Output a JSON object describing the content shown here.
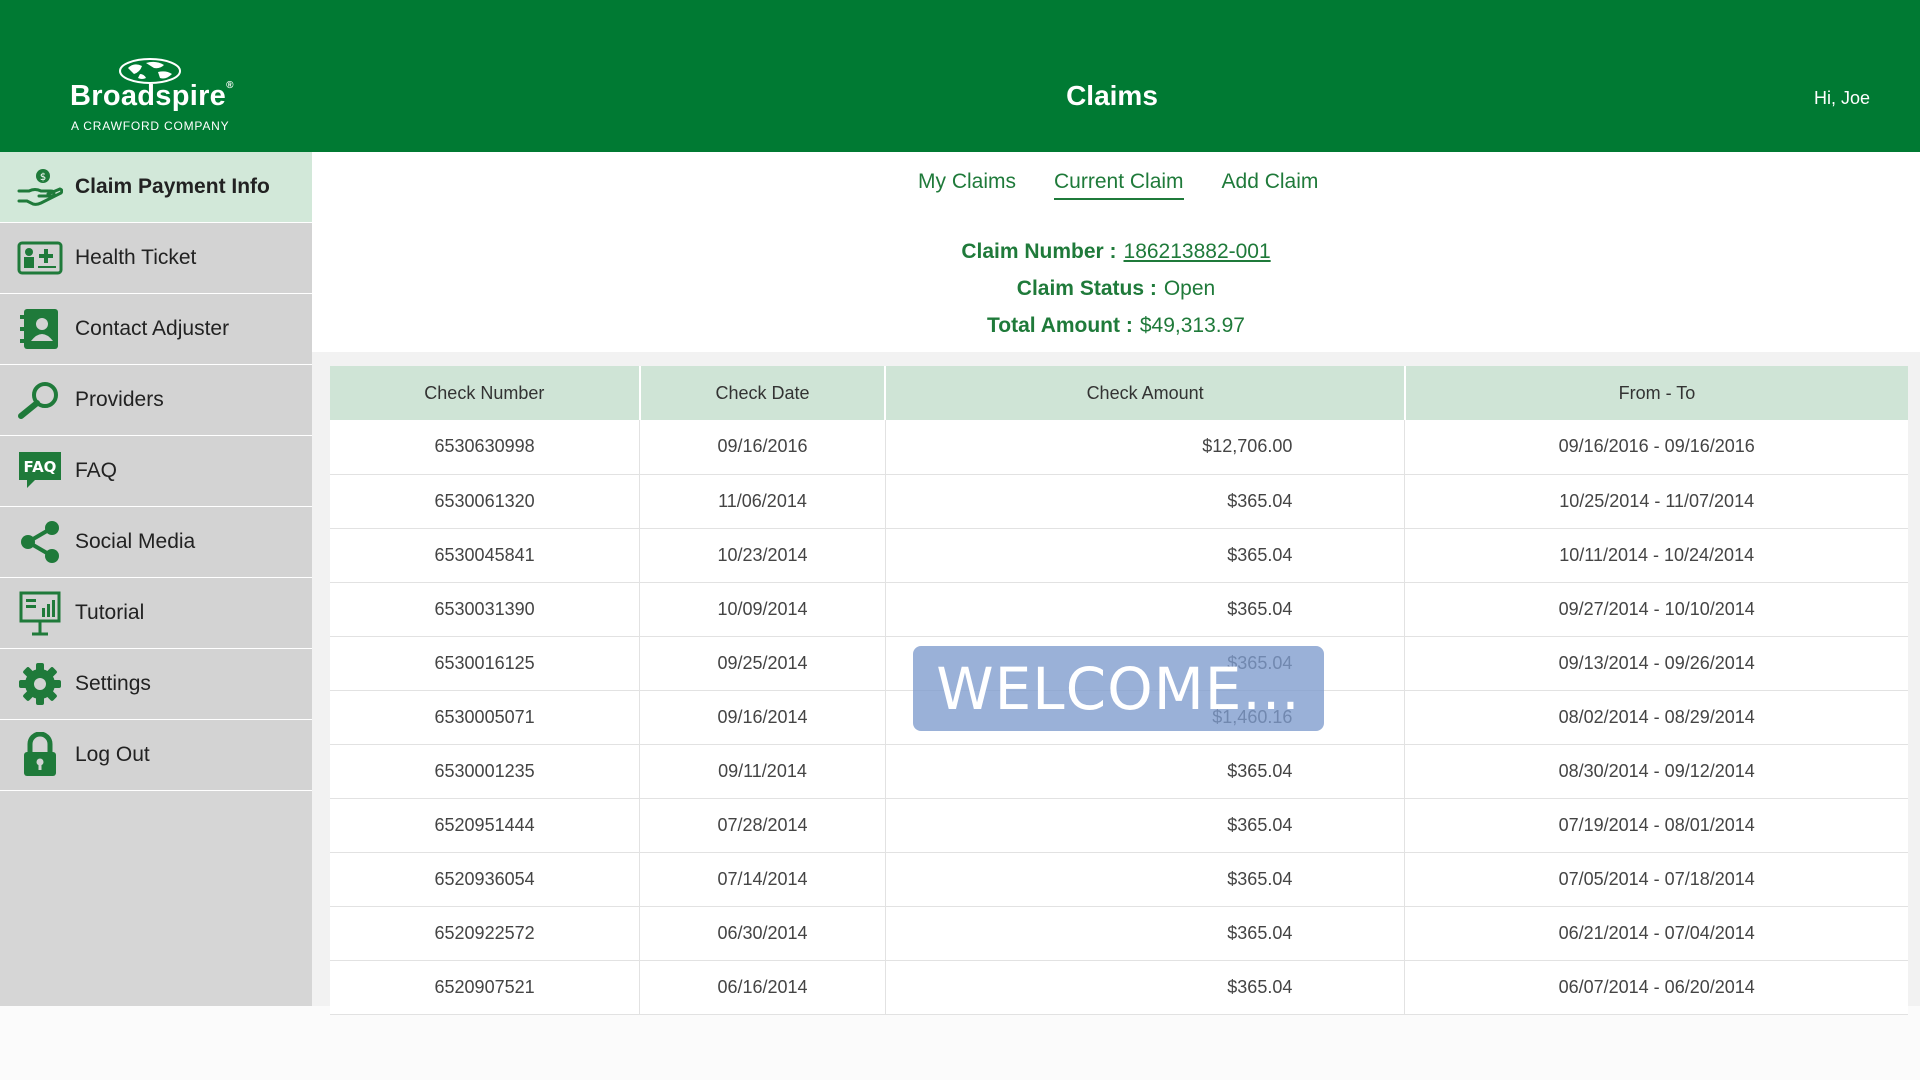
{
  "header": {
    "brand": "Broadspire",
    "brand_tagline": "A CRAWFORD COMPANY",
    "title": "Claims",
    "greeting": "Hi, Joe"
  },
  "sidebar": {
    "items": [
      {
        "label": "Claim Payment Info",
        "icon": "hand-money-icon",
        "active": true
      },
      {
        "label": "Health Ticket",
        "icon": "health-card-icon"
      },
      {
        "label": "Contact Adjuster",
        "icon": "contact-book-icon"
      },
      {
        "label": "Providers",
        "icon": "magnifier-icon"
      },
      {
        "label": "FAQ",
        "icon": "faq-icon"
      },
      {
        "label": "Social Media",
        "icon": "share-icon"
      },
      {
        "label": "Tutorial",
        "icon": "presentation-board-icon"
      },
      {
        "label": "Settings",
        "icon": "gear-icon"
      },
      {
        "label": "Log Out",
        "icon": "lock-icon"
      }
    ]
  },
  "tabs": [
    {
      "label": "My Claims"
    },
    {
      "label": "Current Claim",
      "active": true
    },
    {
      "label": "Add Claim"
    }
  ],
  "claim": {
    "number_label": "Claim Number :",
    "number": "186213882-001",
    "status_label": "Claim Status :",
    "status": "Open",
    "total_label": "Total Amount :",
    "total": "$49,313.97"
  },
  "table": {
    "columns": [
      "Check Number",
      "Check Date",
      "Check Amount",
      "From - To"
    ],
    "rows": [
      [
        "6530630998",
        "09/16/2016",
        "$12,706.00",
        "09/16/2016 - 09/16/2016"
      ],
      [
        "6530061320",
        "11/06/2014",
        "$365.04",
        "10/25/2014 - 11/07/2014"
      ],
      [
        "6530045841",
        "10/23/2014",
        "$365.04",
        "10/11/2014 - 10/24/2014"
      ],
      [
        "6530031390",
        "10/09/2014",
        "$365.04",
        "09/27/2014 - 10/10/2014"
      ],
      [
        "6530016125",
        "09/25/2014",
        "$365.04",
        "09/13/2014 - 09/26/2014"
      ],
      [
        "6530005071",
        "09/16/2014",
        "$1,460.16",
        "08/02/2014 - 08/29/2014"
      ],
      [
        "6530001235",
        "09/11/2014",
        "$365.04",
        "08/30/2014 - 09/12/2014"
      ],
      [
        "6520951444",
        "07/28/2014",
        "$365.04",
        "07/19/2014 - 08/01/2014"
      ],
      [
        "6520936054",
        "07/14/2014",
        "$365.04",
        "07/05/2014 - 07/18/2014"
      ],
      [
        "6520922572",
        "06/30/2014",
        "$365.04",
        "06/21/2014 - 07/04/2014"
      ],
      [
        "6520907521",
        "06/16/2014",
        "$365.04",
        "06/07/2014 - 06/20/2014"
      ]
    ]
  },
  "overlay": {
    "text": "WELCOME..."
  },
  "colors": {
    "brand_green": "#007a33",
    "accent_green": "#1f7a3a",
    "table_header": "#cfe4d6",
    "sidebar": "#d3d3d3",
    "sidebar_active": "#d2e8d9"
  }
}
